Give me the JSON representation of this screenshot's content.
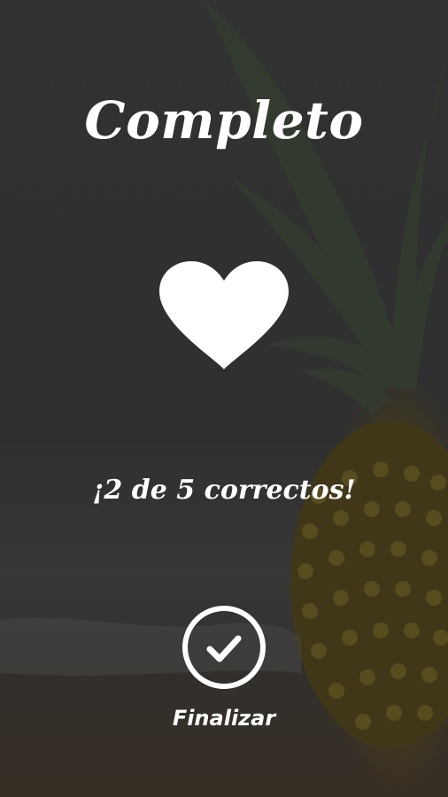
{
  "screen": {
    "title": "Completo",
    "score_text": "¡2 de 5 correctos!",
    "finish_label": "Finalizar"
  },
  "icons": {
    "result": "heart-icon",
    "finish": "check-circle-icon"
  },
  "colors": {
    "text": "#ffffff",
    "overlay": "#2a2a2a",
    "icon": "#ffffff"
  }
}
